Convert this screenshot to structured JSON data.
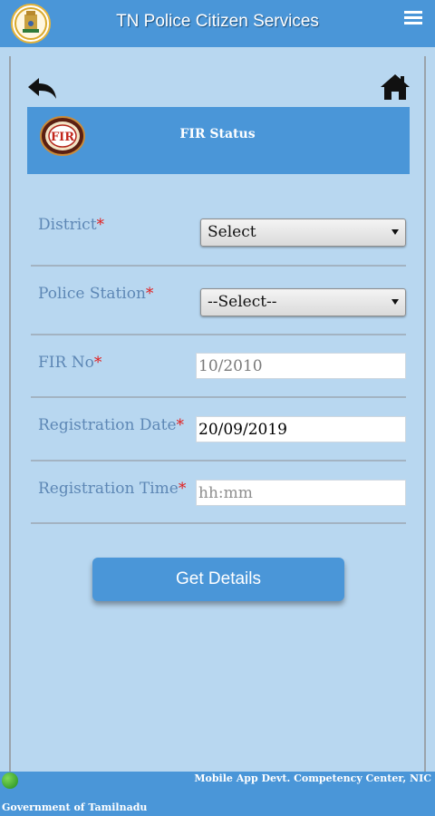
{
  "app": {
    "title": "TN Police Citizen Services"
  },
  "icons": {
    "emblem": "tamilnadu-emblem-icon",
    "menu": "hamburger-menu-icon",
    "back": "back-arrow-icon",
    "home": "home-icon",
    "fir_logo": "fir-logo-icon",
    "status": "globe-icon"
  },
  "banner": {
    "title": "FIR Status",
    "logo_text": "FIR"
  },
  "form": {
    "district": {
      "label": "District",
      "required": "*",
      "value": "Select"
    },
    "police_station": {
      "label": "Police Station",
      "required": "*",
      "value": "--Select--"
    },
    "fir_no": {
      "label": "FIR No",
      "required": "*",
      "value": "10/2010"
    },
    "registration_date": {
      "label": "Registration Date",
      "required": "*",
      "value": "20/09/2019"
    },
    "registration_time": {
      "label": "Registration Time",
      "required": "*",
      "placeholder": "hh:mm"
    },
    "submit_label": "Get Details"
  },
  "footer": {
    "right_text": "Mobile App Devt. Competency Center, NIC",
    "left_text": "Government of Tamilnadu"
  },
  "colors": {
    "primary": "#4a96d8",
    "background": "#b8d7f0",
    "label": "#5d87b5",
    "required": "#e21c1c"
  }
}
